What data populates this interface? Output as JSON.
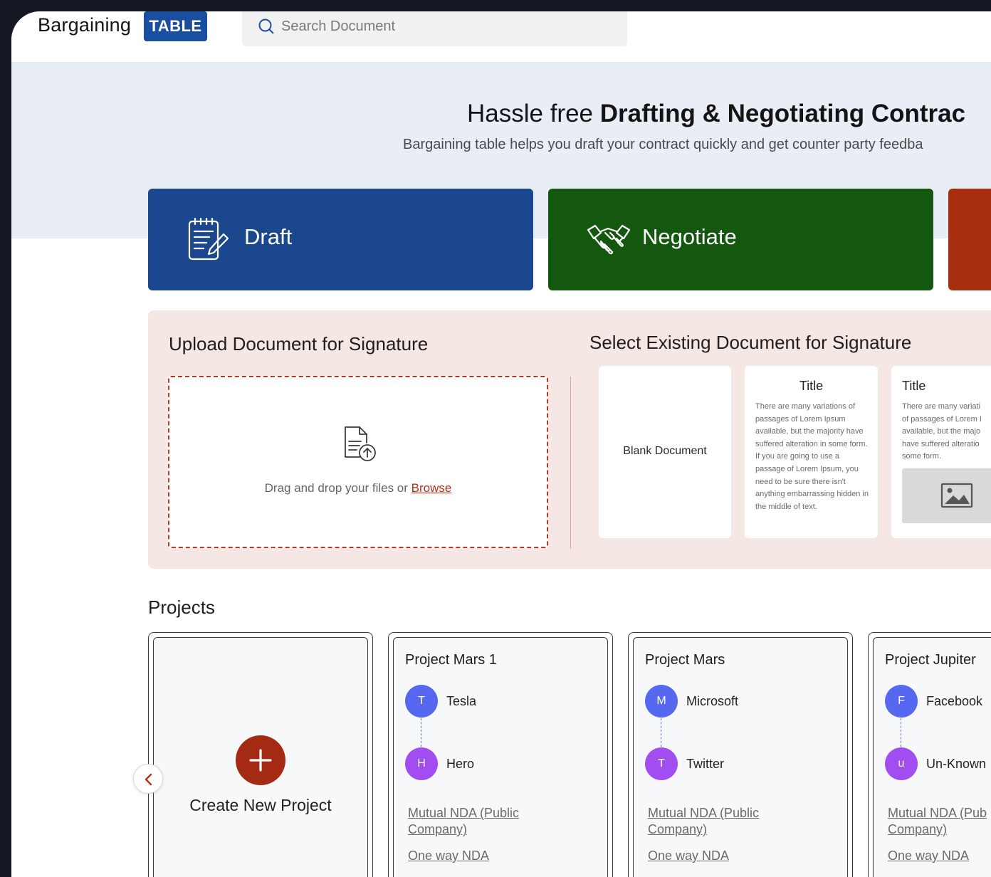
{
  "header": {
    "logo_text": "Bargaining",
    "logo_badge": "TABLE",
    "search_placeholder": "Search Document"
  },
  "hero": {
    "title_light": "Hassle free ",
    "title_bold": "Drafting & Negotiating Contrac",
    "subtitle": "Bargaining table helps you draft your contract quickly and get counter party feedba"
  },
  "actions": {
    "draft_label": "Draft",
    "negotiate_label": "Negotiate"
  },
  "signature": {
    "upload_title": "Upload Document for Signature",
    "drop_text": "Drag and drop your files or ",
    "browse_label": "Browse",
    "existing_title": "Select Existing Document for Signature",
    "blank_label": "Blank Document",
    "templates": [
      {
        "title": "Title",
        "body_1": "There are many variations of passages of Lorem Ipsum available, but the majority have suffered alteration in some form.",
        "body_2": "If you are going to use a passage of Lorem Ipsum, you need to be sure there isn't anything embarrassing hidden in the middle of text."
      },
      {
        "title": "Title",
        "lines": [
          "There are many variati",
          "of passages of Lorem I",
          "available, but the majo",
          "have suffered alteratio",
          "some form."
        ]
      }
    ]
  },
  "projects": {
    "title": "Projects",
    "create_label": "Create New Project",
    "items": [
      {
        "name": "Project Mars 1",
        "party_a": {
          "initial": "T",
          "name": "Tesla"
        },
        "party_b": {
          "initial": "H",
          "name": "Hero"
        },
        "link_1": "Mutual NDA (Public Company)",
        "link_2": "One way NDA"
      },
      {
        "name": "Project Mars",
        "party_a": {
          "initial": "M",
          "name": "Microsoft"
        },
        "party_b": {
          "initial": "T",
          "name": "Twitter"
        },
        "link_1": "Mutual NDA (Public Company)",
        "link_2": "One way NDA"
      },
      {
        "name": "Project Jupiter",
        "party_a": {
          "initial": "F",
          "name": "Facebook"
        },
        "party_b": {
          "initial": "u",
          "name": "Un-Known"
        },
        "link_1": "Mutual NDA (Pub Company)",
        "link_2": "One way NDA"
      }
    ]
  },
  "colors": {
    "brand_blue": "#1a4fa0",
    "draft": "#1a478d",
    "negotiate": "#14570f",
    "sign": "#a72f10",
    "accent_red": "#a52a14",
    "party_a": "#5668f0",
    "party_b": "#a24df0"
  },
  "icons": [
    "search-icon",
    "notepad-icon",
    "handshake-icon",
    "file-upload-icon",
    "image-icon",
    "plus-icon",
    "chevron-left-icon"
  ]
}
